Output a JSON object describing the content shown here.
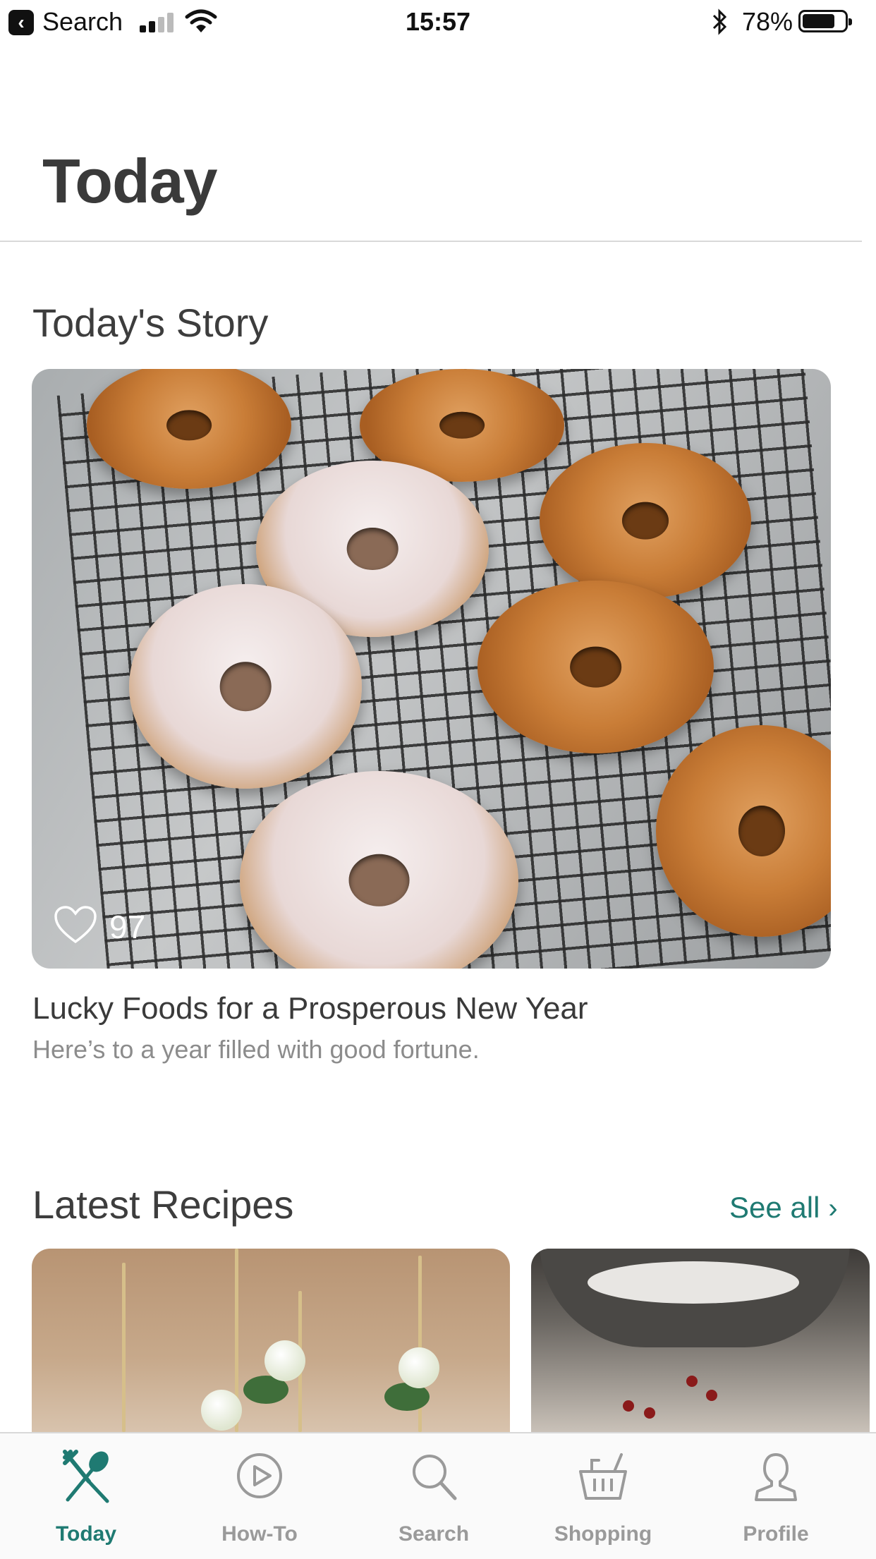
{
  "status_bar": {
    "back_label": "Search",
    "time": "15:57",
    "battery_percent": "78%",
    "battery_level": 0.78,
    "signal_bars": 2
  },
  "header": {
    "title": "Today"
  },
  "story": {
    "heading": "Today's Story",
    "likes": "97",
    "title": "Lucky Foods for a Prosperous New Year",
    "subtitle": "Here’s to a year filled with good fortune."
  },
  "latest": {
    "heading": "Latest Recipes",
    "see_all": "See all"
  },
  "tabs": [
    {
      "label": "Today",
      "icon": "fork-spoon-icon",
      "active": true
    },
    {
      "label": "How-To",
      "icon": "play-icon",
      "active": false
    },
    {
      "label": "Search",
      "icon": "search-icon",
      "active": false
    },
    {
      "label": "Shopping",
      "icon": "basket-icon",
      "active": false
    },
    {
      "label": "Profile",
      "icon": "person-icon",
      "active": false
    }
  ],
  "colors": {
    "accent": "#1f7a72",
    "inactive": "#9a9a9a",
    "text": "#3d3d3d"
  }
}
